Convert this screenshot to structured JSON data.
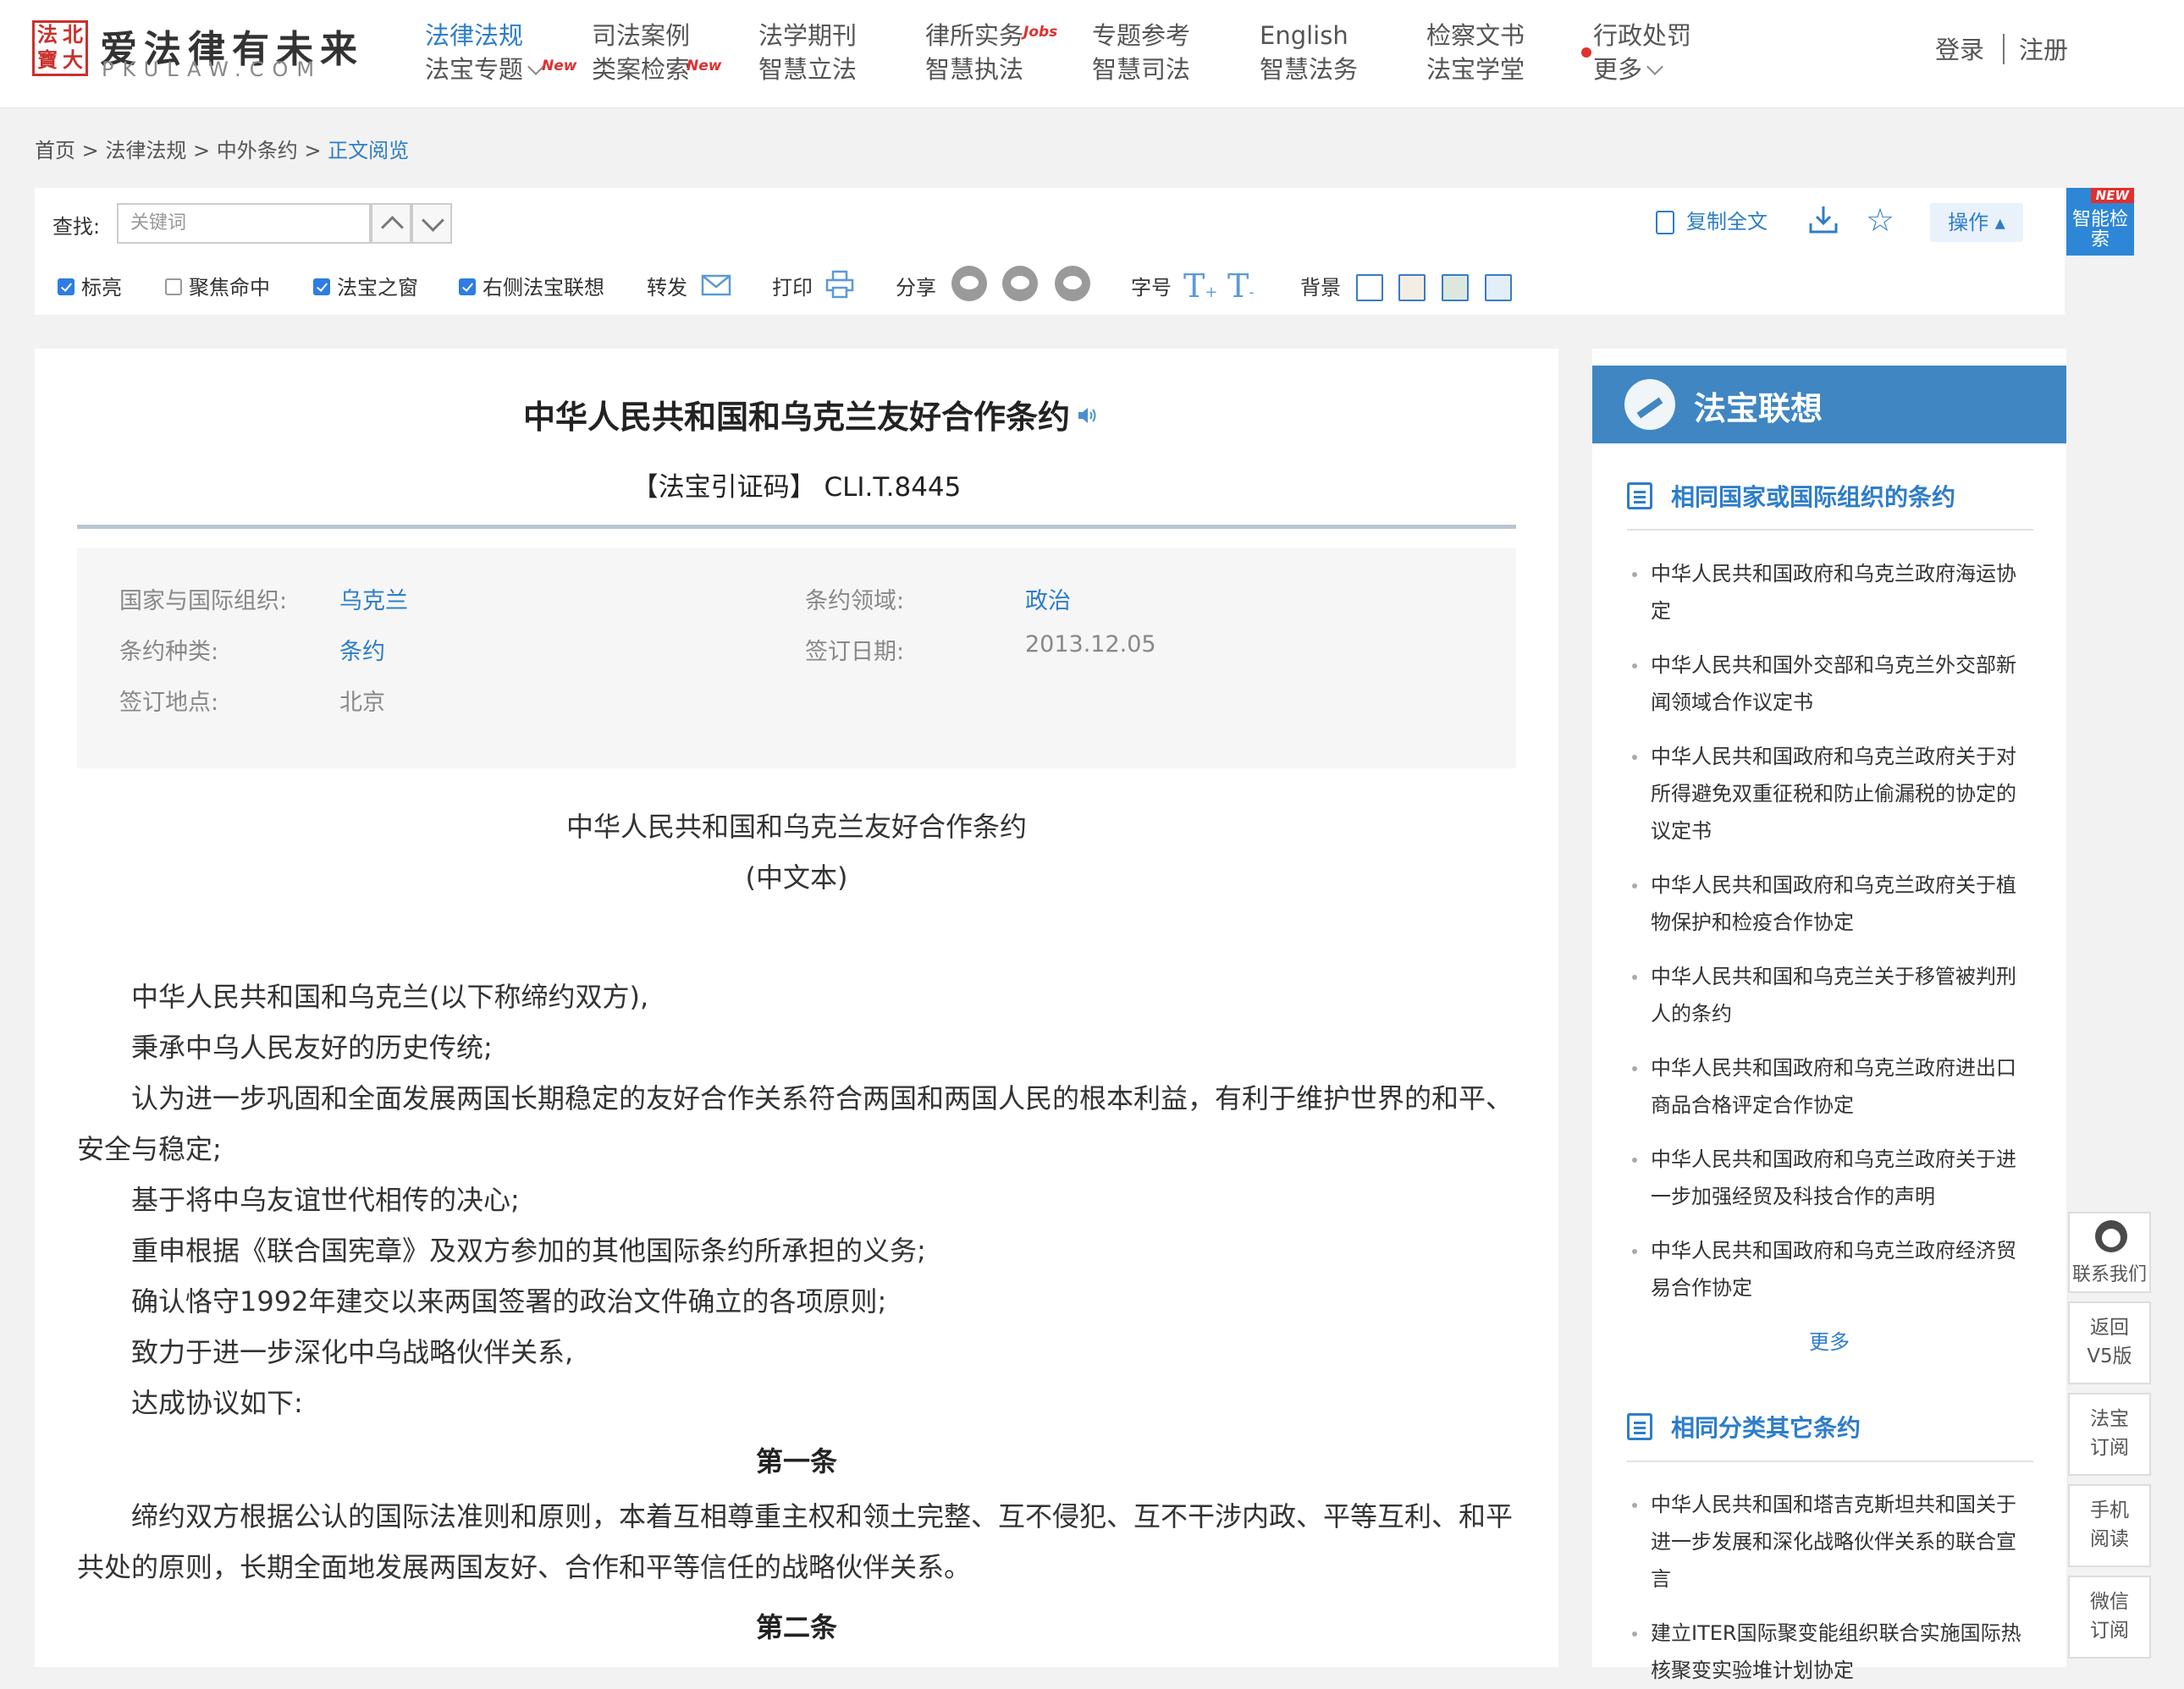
{
  "logo": {
    "seal": [
      "法",
      "北",
      "寶",
      "大"
    ],
    "cn": "爱法律有未来",
    "en": "PKULAW.COM"
  },
  "nav": [
    {
      "top": "法律法规",
      "bottom": "法宝专题",
      "bottom_new": "New"
    },
    {
      "top": "司法案例",
      "bottom": "类案检索",
      "bottom_new": "New"
    },
    {
      "top": "法学期刊",
      "bottom": "智慧立法"
    },
    {
      "top": "律所实务",
      "top_badge": "Jobs",
      "bottom": "智慧执法"
    },
    {
      "top": "专题参考",
      "bottom": "智慧司法"
    },
    {
      "top": "English",
      "bottom": "智慧法务"
    },
    {
      "top": "检察文书",
      "bottom": "法宝学堂"
    },
    {
      "top": "行政处罚",
      "bottom": "更多"
    }
  ],
  "auth": {
    "login": "登录",
    "register": "注册"
  },
  "breadcrumb": {
    "home": "首页",
    "sep": " > ",
    "level1": "法律法规",
    "level2": "中外条约",
    "current": "正文阅览"
  },
  "toolbar": {
    "find_label": "查找:",
    "search_placeholder": "关键词",
    "copy_all": "复制全文",
    "ops": "操作",
    "smart_search_badge": "NEW",
    "smart_search": "智能检索",
    "options": {
      "highlight": "标亮",
      "focus": "聚焦命中",
      "window": "法宝之窗",
      "assoc": "右侧法宝联想",
      "forward": "转发",
      "print": "打印",
      "share": "分享",
      "font_size": "字号",
      "background": "背景"
    },
    "checked": {
      "highlight": true,
      "focus": false,
      "window": true,
      "assoc": true
    },
    "bg_colors": [
      "#ffffff",
      "#f4ede4",
      "#dbe8de",
      "#e4eef8"
    ]
  },
  "doc": {
    "title": "中华人民共和国和乌克兰友好合作条约",
    "cite": "【法宝引证码】 CLI.T.8445",
    "meta": {
      "country_key": "国家与国际组织:",
      "country": "乌克兰",
      "domain_key": "条约领域:",
      "domain": "政治",
      "type_key": "条约种类:",
      "type": "条约",
      "date_key": "签订日期:",
      "date": "2013.12.05",
      "place_key": "签订地点:",
      "place": "北京"
    },
    "name": "中华人民共和国和乌克兰友好合作条约",
    "version": "(中文本)",
    "paragraphs": [
      "中华人民共和国和乌克兰(以下称缔约双方),",
      "秉承中乌人民友好的历史传统;",
      "认为进一步巩固和全面发展两国长期稳定的友好合作关系符合两国和两国人民的根本利益，有利于维护世界的和平、安全与稳定;",
      "基于将中乌友谊世代相传的决心;",
      "重申根据《联合国宪章》及双方参加的其他国际条约所承担的义务;",
      "确认恪守1992年建交以来两国签署的政治文件确立的各项原则;",
      "致力于进一步深化中乌战略伙伴关系,",
      "达成协议如下:"
    ],
    "article1_title": "第一条",
    "article1_text": "缔约双方根据公认的国际法准则和原则，本着互相尊重主权和领土完整、互不侵犯、互不干涉内政、平等互利、和平共处的原则，长期全面地发展两国友好、合作和平等信任的战略伙伴关系。",
    "article2_title": "第二条"
  },
  "side": {
    "head": "法宝联想",
    "sec1_title": "相同国家或国际组织的条约",
    "sec1_items": [
      "中华人民共和国政府和乌克兰政府海运协定",
      "中华人民共和国外交部和乌克兰外交部新闻领域合作议定书",
      "中华人民共和国政府和乌克兰政府关于对所得避免双重征税和防止偷漏税的协定的议定书",
      "中华人民共和国政府和乌克兰政府关于植物保护和检疫合作协定",
      "中华人民共和国和乌克兰关于移管被判刑人的条约",
      "中华人民共和国政府和乌克兰政府进出口商品合格评定合作协定",
      "中华人民共和国政府和乌克兰政府关于进一步加强经贸及科技合作的声明",
      "中华人民共和国政府和乌克兰政府经济贸易合作协定"
    ],
    "more": "更多",
    "sec2_title": "相同分类其它条约",
    "sec2_items": [
      "中华人民共和国和塔吉克斯坦共和国关于进一步发展和深化战略伙伴关系的联合宣言",
      "建立ITER国际聚变能组织联合实施国际热核聚变实验堆计划协定"
    ]
  },
  "floats": {
    "contact": "联系我们",
    "v5": [
      "返回",
      "V5版"
    ],
    "subscribe": [
      "法宝",
      "订阅"
    ],
    "mobile": [
      "手机",
      "阅读"
    ],
    "wechat": [
      "微信",
      "订阅"
    ]
  }
}
